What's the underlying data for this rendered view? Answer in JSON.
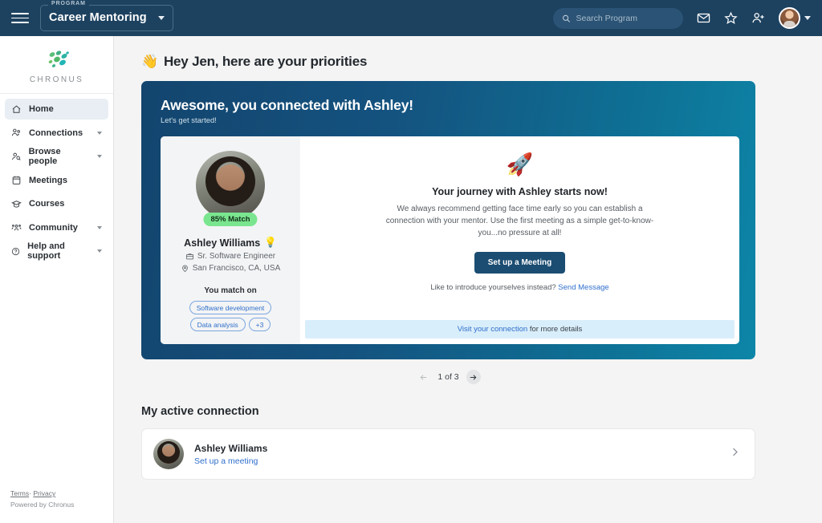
{
  "topbar": {
    "menu_icon": "hamburger-icon",
    "program_legend": "PROGRAM",
    "program_name": "Career Mentoring",
    "search_placeholder": "Search Program",
    "search_value": "",
    "icons": [
      "mail-icon",
      "star-icon",
      "add-person-icon"
    ],
    "bg_color": "#1d4260"
  },
  "sidebar": {
    "logo_word": "CHRONUS",
    "items": [
      {
        "label": "Home",
        "icon": "home-icon",
        "active": true,
        "expandable": false
      },
      {
        "label": "Connections",
        "icon": "people-icon",
        "active": false,
        "expandable": true
      },
      {
        "label": "Browse people",
        "icon": "person-search-icon",
        "active": false,
        "expandable": true
      },
      {
        "label": "Meetings",
        "icon": "calendar-icon",
        "active": false,
        "expandable": false
      },
      {
        "label": "Courses",
        "icon": "graduation-cap-icon",
        "active": false,
        "expandable": false
      },
      {
        "label": "Community",
        "icon": "community-icon",
        "active": false,
        "expandable": true
      },
      {
        "label": "Help and support",
        "icon": "help-circle-icon",
        "active": false,
        "expandable": true
      }
    ],
    "footer": {
      "terms": "Terms",
      "separator": "·",
      "privacy": "Privacy",
      "powered": "Powered by Chronus"
    }
  },
  "main": {
    "page_title": "Hey Jen, here are your priorities",
    "page_title_emoji": "👋",
    "hero": {
      "title": "Awesome, you connected with Ashley!",
      "subtitle": "Let's get started!",
      "gradient_from": "#13456e",
      "gradient_to": "#0d86a8",
      "profile": {
        "match_badge": "85% Match",
        "name": "Ashley Williams",
        "name_emoji": "💡",
        "job_title": "Sr. Software Engineer",
        "location": "San Francisco, CA, USA",
        "match_on_label": "You match on",
        "tags": [
          "Software development",
          "Data analysis",
          "+3"
        ]
      },
      "journey": {
        "emoji": "🚀",
        "title": "Your journey with Ashley starts now!",
        "body": "We always recommend getting face time early so you can establish a connection with your mentor. Use the first meeting as a simple get-to-know-you...no pressure at all!",
        "cta_label": "Set up a Meeting",
        "alt_text": "Like to introduce yourselves instead?",
        "alt_link": "Send Message",
        "visit_link": "Visit your connection",
        "visit_rest": "for more details"
      }
    },
    "pager": {
      "prev_icon": "arrow-left-icon",
      "next_icon": "arrow-right-icon",
      "label": "1 of 3",
      "current": 1,
      "total": 3
    },
    "active_connection": {
      "section_title": "My active connection",
      "name": "Ashley Williams",
      "action_link": "Set up a meeting",
      "chevron_icon": "chevron-right-icon"
    }
  }
}
